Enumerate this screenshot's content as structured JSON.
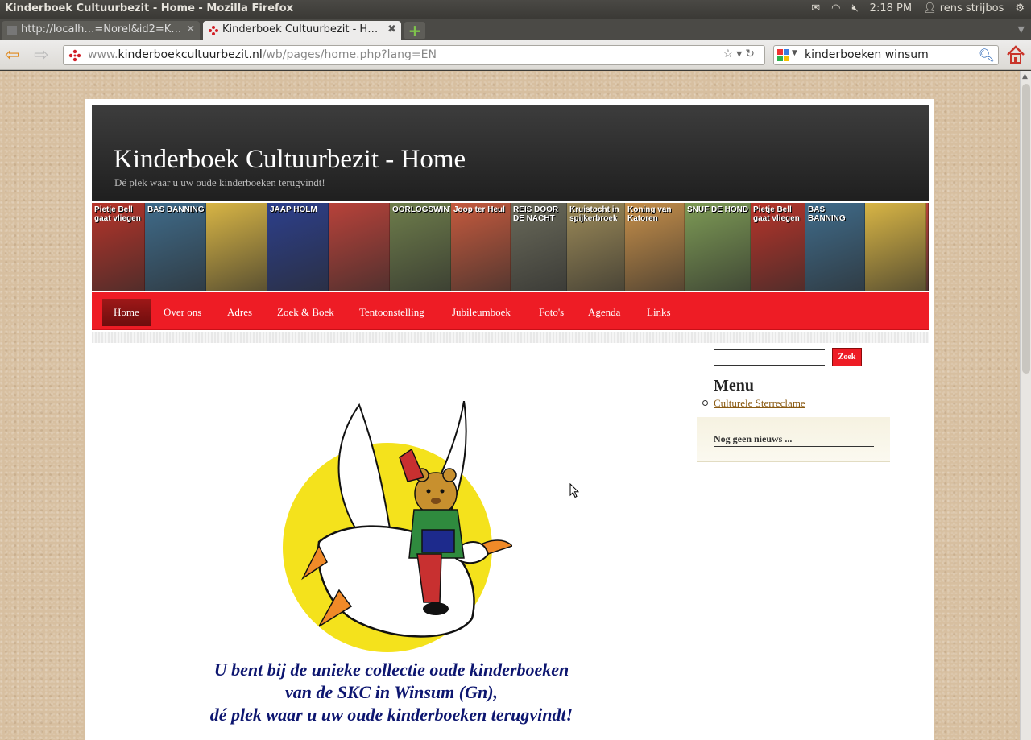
{
  "os": {
    "window_title": "Kinderboek Cultuurbezit - Home - Mozilla Firefox",
    "time": "2:18 PM",
    "user": "rens strijbos",
    "icons": [
      "mail-icon",
      "wifi-icon",
      "volume-muted-icon",
      "user-icon",
      "gear-icon"
    ]
  },
  "browser": {
    "tabs": [
      {
        "label": "http://localh…=Norel&id2=K…",
        "active": false
      },
      {
        "label": "Kinderboek Cultuurbezit - H…",
        "active": true
      }
    ],
    "url": {
      "prefix": "www.",
      "domain": "kinderboekcultuurbezit.nl",
      "path": "/wb/pages/home.php?lang=EN"
    },
    "search": {
      "value": "kinderboeken winsum"
    }
  },
  "site": {
    "title": "Kinderboek Cultuurbezit - Home",
    "subtitle": "Dé plek waar u uw oude kinderboeken terugvindt!",
    "banner_covers": [
      {
        "text": "Pietje Bell gaat vliegen",
        "color": "#b7342a"
      },
      {
        "text": "BAS BANNING",
        "color": "#3f6b8a"
      },
      {
        "text": "",
        "color": "#d8b545"
      },
      {
        "text": "JAAP HOLM",
        "color": "#2c3f8c"
      },
      {
        "text": "",
        "color": "#b8423a"
      },
      {
        "text": "OORLOGSWINTER",
        "color": "#6e7d4b"
      },
      {
        "text": "Joop ter Heul",
        "color": "#c55a3e"
      },
      {
        "text": "REIS DOOR DE NACHT",
        "color": "#6a6a5a"
      },
      {
        "text": "Kruistocht in spijkerbroek",
        "color": "#9c8a58"
      },
      {
        "text": "Koning van Katoren",
        "color": "#c68f4a"
      },
      {
        "text": "SNUF DE HOND",
        "color": "#7d9a55"
      },
      {
        "text": "Pietje Bell gaat vliegen",
        "color": "#b7342a"
      },
      {
        "text": "BAS BANNING",
        "color": "#3f6b8a"
      },
      {
        "text": "",
        "color": "#d8b545"
      },
      {
        "text": "",
        "color": "#b8423a"
      }
    ],
    "nav": [
      {
        "label": "Home",
        "active": true
      },
      {
        "label": "Over ons"
      },
      {
        "label": "Adres"
      },
      {
        "label": "Zoek & Boek"
      },
      {
        "label": "Tentoonstelling"
      },
      {
        "label": "Jubileumboek"
      },
      {
        "label": "Foto's"
      },
      {
        "label": "Agenda"
      },
      {
        "label": "Links"
      }
    ],
    "sidebar": {
      "search_button": "Zoek",
      "menu_title": "Menu",
      "menu_items": [
        "Culturele Sterreclame"
      ],
      "news": "Nog geen nieuws ..."
    },
    "intro_lines": [
      "U bent bij de unieke collectie oude kinderboeken",
      "van de SKC in Winsum (Gn),",
      "dé plek waar u uw oude kinderboeken terugvindt!"
    ],
    "colors": {
      "nav_red": "#ee1c25",
      "intro_blue": "#0d1670",
      "link_brown": "#8a5a12"
    }
  }
}
